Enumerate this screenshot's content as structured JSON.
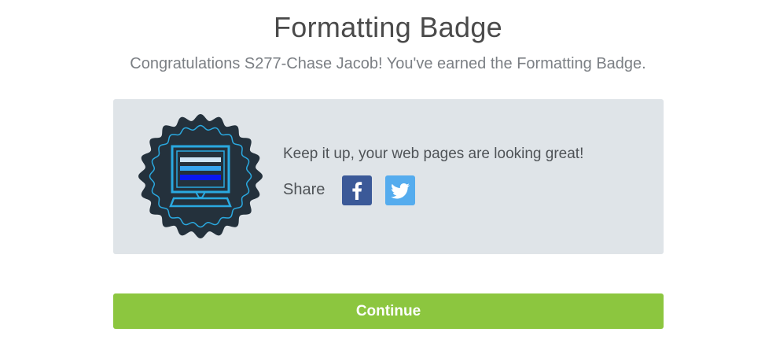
{
  "header": {
    "title": "Formatting Badge",
    "subtitle": "Congratulations S277-Chase Jacob! You've earned the Formatting Badge."
  },
  "card": {
    "badge_icon": "computer-monitor-badge-icon",
    "message": "Keep it up, your web pages are looking great!",
    "share_label": "Share",
    "facebook_icon": "facebook-icon",
    "twitter_icon": "twitter-icon"
  },
  "actions": {
    "continue_label": "Continue"
  },
  "colors": {
    "card_bg": "#dfe4e8",
    "badge_dark": "#24313c",
    "badge_accent": "#2aa9e0",
    "facebook": "#3b5998",
    "twitter": "#55acee",
    "continue_button": "#8cc63f"
  }
}
